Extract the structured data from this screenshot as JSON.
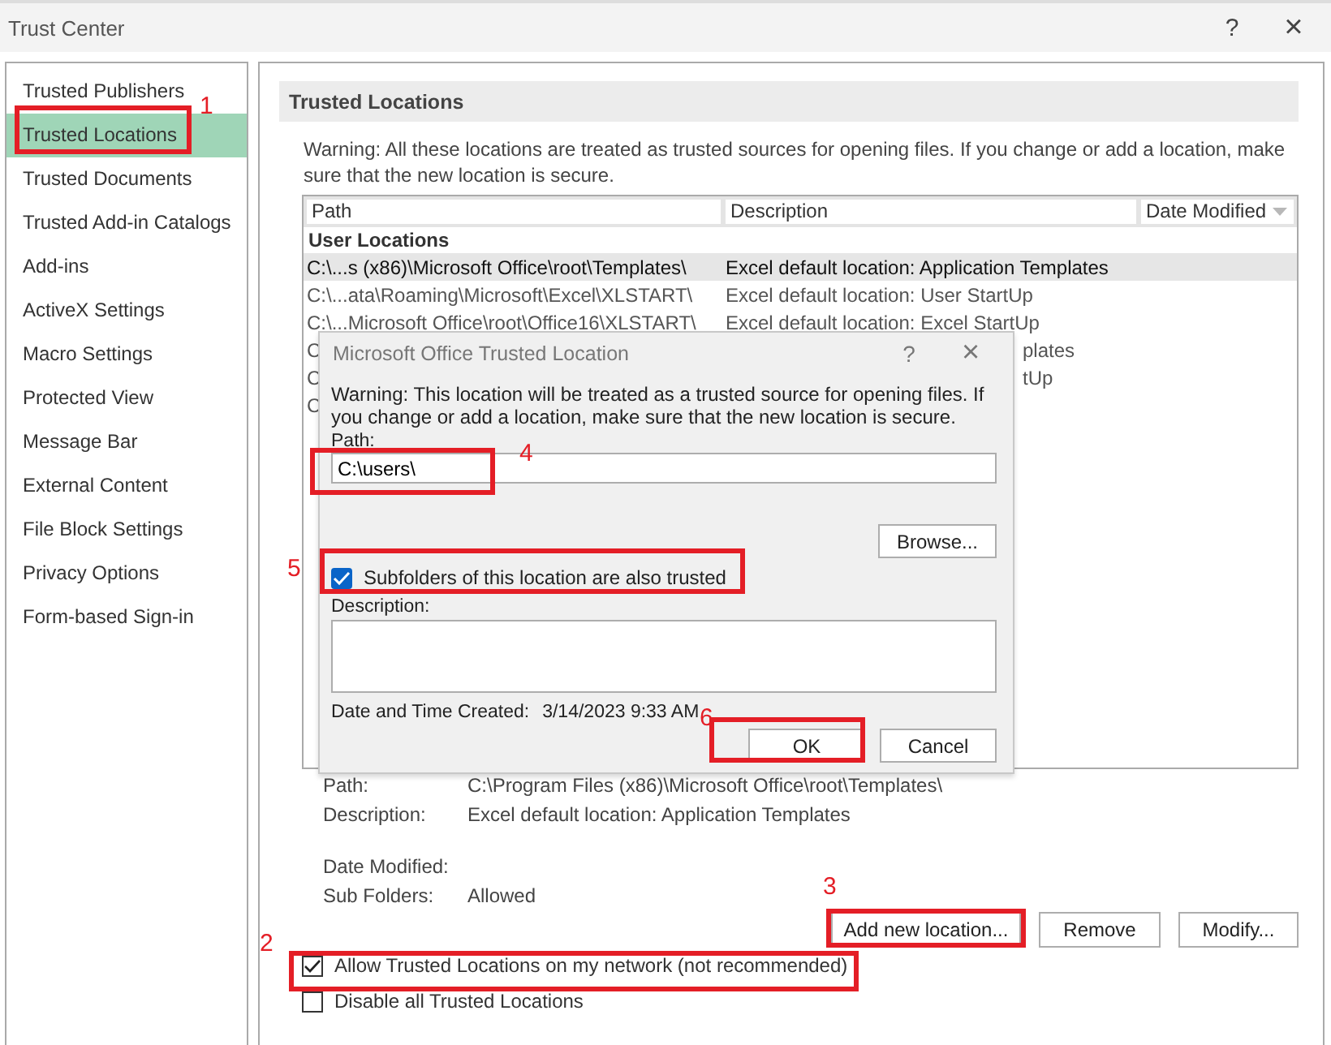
{
  "window": {
    "title": "Trust Center",
    "buttons": [
      "?",
      "×"
    ]
  },
  "sidebar": {
    "items": [
      {
        "label": "Trusted Publishers",
        "selected": false
      },
      {
        "label": "Trusted Locations",
        "selected": true
      },
      {
        "label": "Trusted Documents",
        "selected": false
      },
      {
        "label": "Trusted Add-in Catalogs",
        "selected": false
      },
      {
        "label": "Add-ins",
        "selected": false
      },
      {
        "label": "ActiveX Settings",
        "selected": false
      },
      {
        "label": "Macro Settings",
        "selected": false
      },
      {
        "label": "Protected View",
        "selected": false
      },
      {
        "label": "Message Bar",
        "selected": false
      },
      {
        "label": "External Content",
        "selected": false
      },
      {
        "label": "File Block Settings",
        "selected": false
      },
      {
        "label": "Privacy Options",
        "selected": false
      },
      {
        "label": "Form-based Sign-in",
        "selected": false
      }
    ]
  },
  "section": {
    "title": "Trusted Locations",
    "warning": "Warning: All these locations are treated as trusted sources for opening files.  If you change or add a location, make sure that the new location is secure."
  },
  "table": {
    "columns": [
      "Path",
      "Description",
      "Date Modified"
    ],
    "group": "User Locations",
    "rows": [
      {
        "kind": "full",
        "path": "C:\\...s (x86)\\Microsoft Office\\root\\Templates\\",
        "description": "Excel default location: Application Templates",
        "selected": true
      },
      {
        "kind": "full",
        "path": "C:\\...ata\\Roaming\\Microsoft\\Excel\\XLSTART\\",
        "description": "Excel default location: User StartUp",
        "selected": false
      },
      {
        "kind": "full",
        "path": "C:\\...Microsoft Office\\root\\Office16\\XLSTART\\",
        "description": "Excel default location: Excel StartUp",
        "selected": false
      },
      {
        "kind": "covered",
        "path": "C",
        "description": "plates",
        "selected": false
      },
      {
        "kind": "covered",
        "path": "C",
        "description": "tUp",
        "selected": false
      },
      {
        "kind": "covered",
        "path": "C",
        "selected": false
      }
    ]
  },
  "details": [
    {
      "label": "Path:",
      "value": "C:\\Program Files (x86)\\Microsoft Office\\root\\Templates\\"
    },
    {
      "label": "Description:",
      "value": "Excel default location: Application Templates"
    },
    {
      "label": "Date Modified:"
    },
    {
      "label": "Sub Folders:",
      "value": "Allowed"
    }
  ],
  "actions": [
    "Add new location...",
    "Remove",
    "Modify..."
  ],
  "options": [
    {
      "label": "Allow Trusted Locations on my network (not recommended)",
      "checked": true
    },
    {
      "label": "Disable all Trusted Locations",
      "checked": false
    }
  ],
  "dialog": {
    "title": "Microsoft Office Trusted Location",
    "buttons": [
      "?",
      "×"
    ],
    "warning": "Warning: This location will be treated as a trusted source for opening files. If you change or add a location, make sure that the new location is secure.",
    "path_label": "Path:",
    "path_value": "C:\\users\\",
    "browse": "Browse...",
    "subfolders": {
      "label": "Subfolders of this location are also trusted",
      "checked": true
    },
    "description_label": "Description:",
    "created_label": "Date and Time Created:",
    "created_value": "3/14/2023 9:33 AM",
    "ok": "OK",
    "cancel": "Cancel"
  },
  "annotations": [
    {
      "label": "1"
    },
    {
      "label": "2"
    },
    {
      "label": "3"
    },
    {
      "label": "4"
    },
    {
      "label": "5"
    },
    {
      "label": "6"
    }
  ]
}
